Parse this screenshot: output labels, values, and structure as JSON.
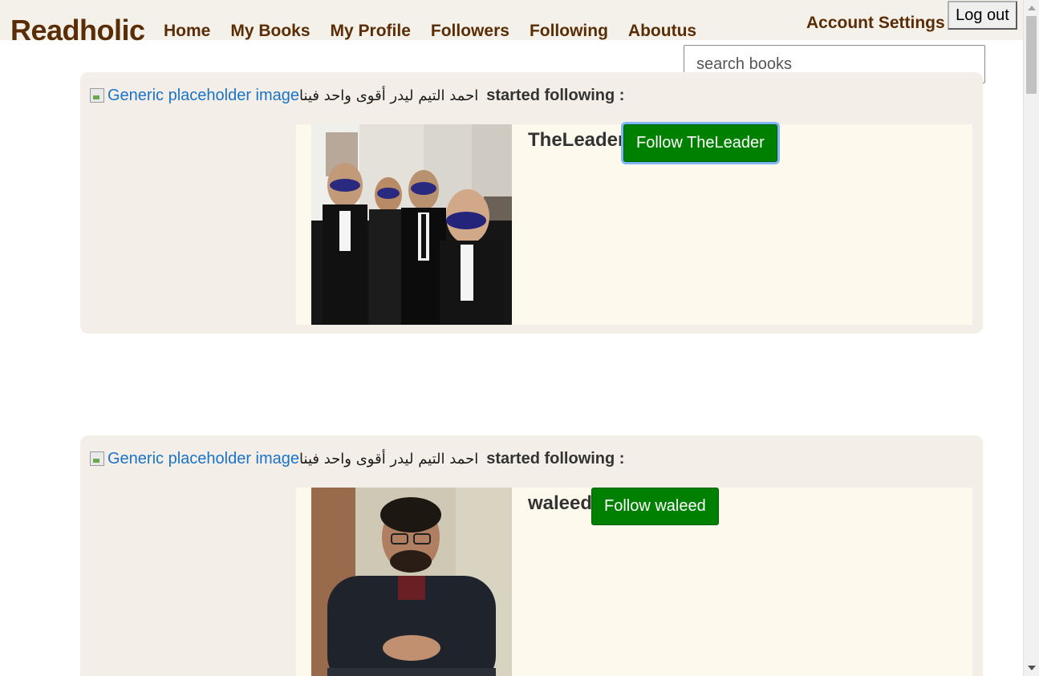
{
  "navbar": {
    "brand": "Readholic",
    "links": [
      "Home",
      "My Books",
      "My Profile",
      "Followers",
      "Following",
      "Aboutus"
    ],
    "account_settings": "Account Settings",
    "logout": "Log out"
  },
  "search": {
    "placeholder": "search books",
    "value": ""
  },
  "feed": [
    {
      "image_alt": "Generic placeholder image",
      "actor": "احمد التيم ليدر أقوى واحد فينا",
      "action": "started following :",
      "target_user": "TheLeader",
      "follow_label": "Follow TheLeader"
    },
    {
      "image_alt": "Generic placeholder image",
      "actor": "احمد التيم ليدر أقوى واحد فينا",
      "action": "started following :",
      "target_user": "waleed",
      "follow_label": "Follow waleed"
    }
  ],
  "colors": {
    "brand": "#5b2d06",
    "navbar_bg": "#f4f1ea",
    "card_bg": "#f3efe8",
    "card_body_bg": "#fdf9ed",
    "follow_button": "#008000",
    "link": "#1a73c8"
  },
  "icons": [
    "broken-image-icon",
    "scroll-up-arrow-icon",
    "scroll-down-arrow-icon"
  ]
}
